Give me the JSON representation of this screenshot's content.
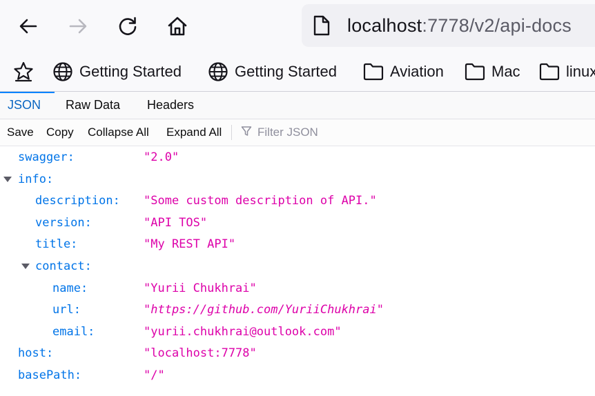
{
  "browser": {
    "url_host": "localhost",
    "url_rest": ":7778/v2/api-docs",
    "icons": {
      "back": "arrow-left-icon",
      "forward": "arrow-right-icon",
      "reload": "reload-icon",
      "home": "home-icon",
      "page": "page-icon"
    }
  },
  "bookmarks": [
    {
      "label": "Getting Started",
      "icon": "globe-icon"
    },
    {
      "label": "Getting Started",
      "icon": "globe-icon"
    },
    {
      "label": "Aviation",
      "icon": "folder-icon"
    },
    {
      "label": "Mac",
      "icon": "folder-icon"
    },
    {
      "label": "linux",
      "icon": "folder-icon"
    }
  ],
  "viewer": {
    "tabs": [
      "JSON",
      "Raw Data",
      "Headers"
    ],
    "selected_tab": "JSON",
    "toolbar": {
      "save": "Save",
      "copy": "Copy",
      "collapse_all": "Collapse All",
      "expand_all": "Expand All",
      "filter_placeholder": "Filter JSON"
    }
  },
  "json_tree": [
    {
      "key": "swagger:",
      "value": "\"2.0\"",
      "depth": 0,
      "expandable": false
    },
    {
      "key": "info:",
      "value": "",
      "depth": 0,
      "expandable": true
    },
    {
      "key": "description:",
      "value": "\"Some custom description of API.\"",
      "depth": 1,
      "expandable": false
    },
    {
      "key": "version:",
      "value": "\"API TOS\"",
      "depth": 1,
      "expandable": false
    },
    {
      "key": "title:",
      "value": "\"My REST API\"",
      "depth": 1,
      "expandable": false
    },
    {
      "key": "contact:",
      "value": "",
      "depth": 1,
      "expandable": true
    },
    {
      "key": "name:",
      "value": "\"Yurii Chukhrai\"",
      "depth": 2,
      "expandable": false
    },
    {
      "key": "url:",
      "value": "\"https://github.com/YuriiChukhrai\"",
      "depth": 2,
      "expandable": false
    },
    {
      "key": "email:",
      "value": "\"yurii.chukhrai@outlook.com\"",
      "depth": 2,
      "expandable": false
    },
    {
      "key": "host:",
      "value": "\"localhost:7778\"",
      "depth": 0,
      "expandable": false
    },
    {
      "key": "basePath:",
      "value": "\"/\"",
      "depth": 0,
      "expandable": false
    }
  ],
  "colors": {
    "key": "#0074e8",
    "string": "#dd00a9",
    "tab_selected": "#0a66c2",
    "tab_underline": "#0a84ff"
  }
}
